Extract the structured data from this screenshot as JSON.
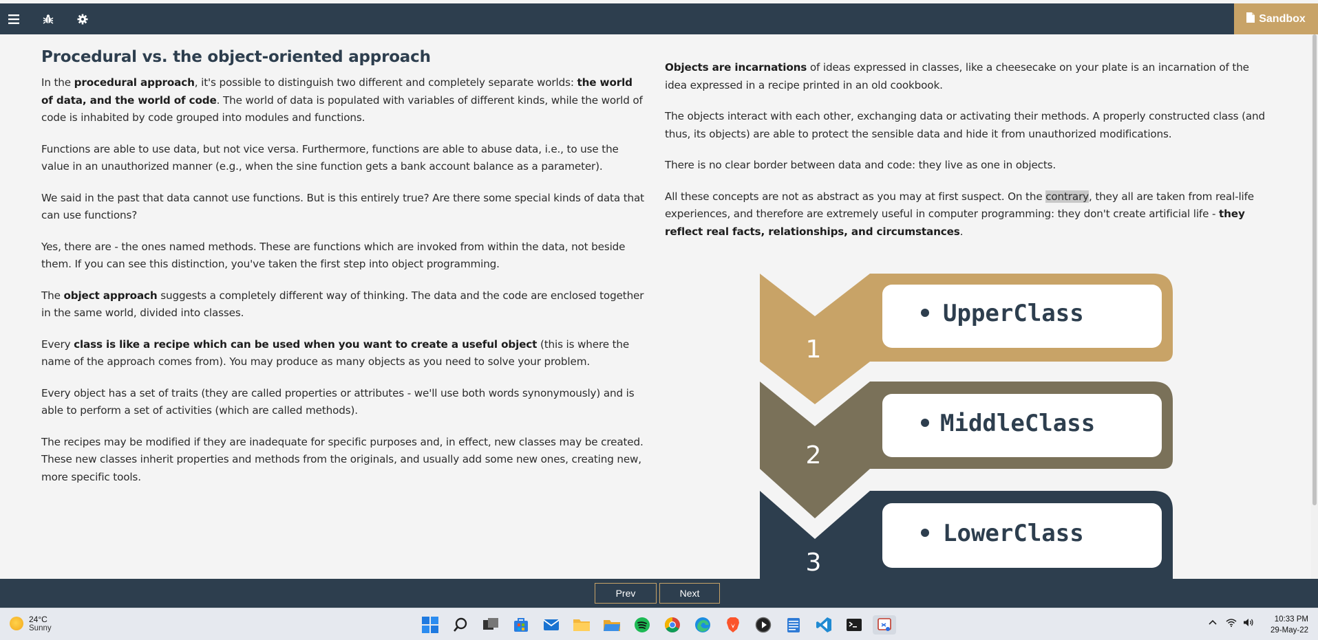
{
  "header": {
    "sandbox_label": "Sandbox"
  },
  "left": {
    "title": "Procedural vs. the object-oriented approach",
    "p1": [
      {
        "t": "In the "
      },
      {
        "t": "procedural approach",
        "b": true
      },
      {
        "t": ", it's possible to distinguish two different and completely separate worlds: "
      },
      {
        "t": "the world of data, and the world of code",
        "b": true
      },
      {
        "t": ". The world of data is populated with variables of different kinds, while the world of code is inhabited by code grouped into modules and functions."
      }
    ],
    "p2": [
      {
        "t": "Functions are able to use data, but not vice versa. Furthermore, functions are able to abuse data, i.e., to use the value in an unauthorized manner (e.g., when the sine function gets a bank account balance as a parameter)."
      }
    ],
    "p3": [
      {
        "t": "We said in the past that data cannot use functions. But is this entirely true? Are there some special kinds of data that can use functions?"
      }
    ],
    "p4": [
      {
        "t": "Yes, there are - the ones named methods. These are functions which are invoked from within the data, not beside them. If you can see this distinction, you've taken the first step into object programming."
      }
    ],
    "p5": [
      {
        "t": "The "
      },
      {
        "t": "object approach",
        "b": true
      },
      {
        "t": " suggests a completely different way of thinking. The data and the code are enclosed together in the same world, divided into classes."
      }
    ],
    "p6": [
      {
        "t": "Every "
      },
      {
        "t": "class is like a recipe which can be used when you want to create a useful object",
        "b": true
      },
      {
        "t": " (this is where the name of the approach comes from). You may produce as many objects as you need to solve your problem."
      }
    ],
    "p7": [
      {
        "t": "Every object has a set of traits (they are called properties or attributes - we'll use both words synonymously) and is able to perform a set of activities (which are called methods)."
      }
    ],
    "p8": [
      {
        "t": "The recipes may be modified if they are inadequate for specific purposes and, in effect, new classes may be created. These new classes inherit properties and methods from the originals, and usually add some new ones, creating new, more specific tools."
      }
    ]
  },
  "right": {
    "p1": [
      {
        "t": "Objects are incarnations",
        "b": true
      },
      {
        "t": " of ideas expressed in classes, like a cheesecake on your plate is an incarnation of the idea expressed in a recipe printed in an old cookbook."
      }
    ],
    "p2": [
      {
        "t": "The objects interact with each other, exchanging data or activating their methods. A properly constructed class (and thus, its objects) are able to protect the sensible data and hide it from unauthorized modifications."
      }
    ],
    "p3": [
      {
        "t": "There is no clear border between data and code: they live as one in objects."
      }
    ],
    "p4": [
      {
        "t": "All these concepts are not as abstract as you may at first suspect. On the "
      },
      {
        "t": "contrary",
        "hl": true
      },
      {
        "t": ", they all are taken from real-life experiences, and therefore are extremely useful in computer programming: they don't create artificial life - "
      },
      {
        "t": "they reflect real facts, relationships, and circumstances",
        "b": true
      },
      {
        "t": "."
      }
    ]
  },
  "diagram": {
    "levels": [
      {
        "num": "1",
        "label": "UpperClass",
        "color": "#c8a367"
      },
      {
        "num": "2",
        "label": "MiddleClass",
        "color": "#7a7159"
      },
      {
        "num": "3",
        "label": "LowerClass",
        "color": "#2d3e4e"
      }
    ]
  },
  "footer": {
    "prev_label": "Prev",
    "next_label": "Next"
  },
  "taskbar": {
    "temp": "24°C",
    "weather": "Sunny",
    "time": "10:33 PM",
    "date": "29-May-22"
  },
  "colors": {
    "nav": "#2d3e4e",
    "gold": "#c8a367",
    "olive": "#7a7159"
  }
}
